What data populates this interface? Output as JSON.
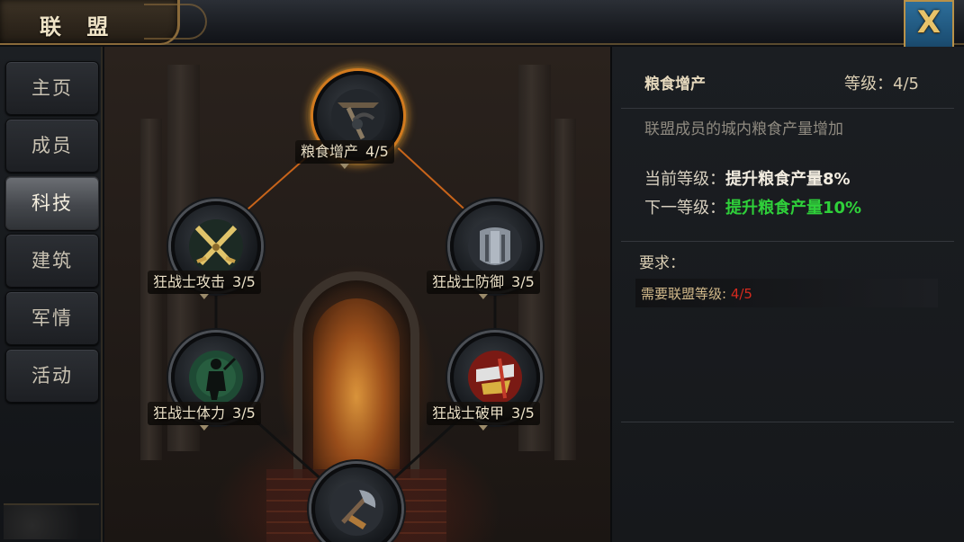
{
  "header": {
    "title": "联 盟",
    "close_label": "X"
  },
  "sidebar": {
    "items": [
      {
        "label": "主页"
      },
      {
        "label": "成员"
      },
      {
        "label": "科技",
        "active": true
      },
      {
        "label": "建筑"
      },
      {
        "label": "军情"
      },
      {
        "label": "活动"
      }
    ]
  },
  "tree": {
    "nodes": [
      {
        "name": "粮食增产",
        "level": "4/5",
        "icon": "food-production-icon",
        "selected": true
      },
      {
        "name": "狂战士攻击",
        "level": "3/5",
        "icon": "crossed-swords-icon"
      },
      {
        "name": "狂战士防御",
        "level": "3/5",
        "icon": "armor-icon"
      },
      {
        "name": "狂战士体力",
        "level": "3/5",
        "icon": "warrior-silhouette-icon"
      },
      {
        "name": "狂战士破甲",
        "level": "3/5",
        "icon": "armor-break-icon"
      },
      {
        "name": "",
        "level": "",
        "icon": "axe-icon"
      }
    ]
  },
  "detail": {
    "name": "粮食增产",
    "level_text": "等级：4/5",
    "description": "联盟成员的城内粮食产量增加",
    "current_label": "当前等级：",
    "current_value": "提升粮食产量8%",
    "next_label": "下一等级：",
    "next_value": "提升粮食产量10%",
    "requirements_title": "要求：",
    "requirement_label": "需要联盟等级: ",
    "requirement_value": "4/5"
  },
  "colors": {
    "accent_gold": "#d27a1e",
    "green": "#2fd03a",
    "red": "#d42a1e",
    "close_blue": "#2d6e9a"
  }
}
